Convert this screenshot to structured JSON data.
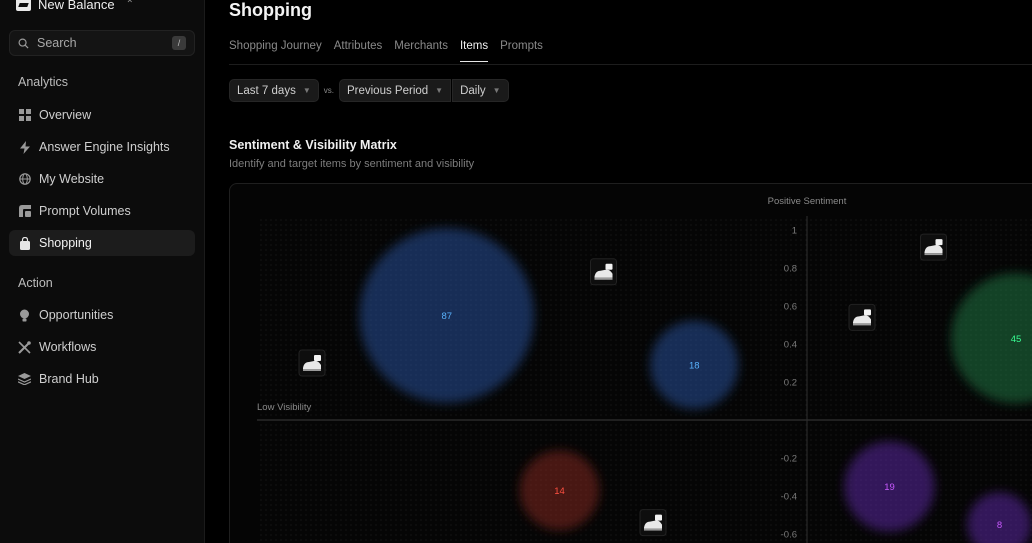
{
  "sidebar": {
    "brand": "New Balance",
    "search": {
      "placeholder": "Search",
      "shortcut": "/"
    },
    "sections": [
      {
        "label": "Analytics",
        "items": [
          {
            "label": "Overview",
            "icon": "grid-icon",
            "active": false
          },
          {
            "label": "Answer Engine Insights",
            "icon": "bolt-icon",
            "active": false
          },
          {
            "label": "My Website",
            "icon": "globe-icon",
            "active": false
          },
          {
            "label": "Prompt Volumes",
            "icon": "chart-icon",
            "active": false
          },
          {
            "label": "Shopping",
            "icon": "bag-icon",
            "active": true
          }
        ]
      },
      {
        "label": "Action",
        "items": [
          {
            "label": "Opportunities",
            "icon": "bulb-icon",
            "active": false
          },
          {
            "label": "Workflows",
            "icon": "tools-icon",
            "active": false
          },
          {
            "label": "Brand Hub",
            "icon": "layers-icon",
            "active": false
          }
        ]
      }
    ]
  },
  "main": {
    "title": "Shopping",
    "tabs": [
      {
        "label": "Shopping Journey",
        "active": false
      },
      {
        "label": "Attributes",
        "active": false
      },
      {
        "label": "Merchants",
        "active": false
      },
      {
        "label": "Items",
        "active": true
      },
      {
        "label": "Prompts",
        "active": false
      }
    ],
    "filters": {
      "range": "Last 7 days",
      "vs": "vs.",
      "compare": "Previous Period",
      "granularity": "Daily"
    },
    "matrix": {
      "title": "Sentiment & Visibility Matrix",
      "subtitle": "Identify and target items by sentiment and visibility"
    }
  },
  "chart_data": {
    "type": "scatter",
    "title": "Sentiment & Visibility Matrix",
    "top_label": "Positive Sentiment",
    "left_label": "Low Visibility",
    "y_ticks": [
      "1",
      "0.8",
      "0.6",
      "0.4",
      "0.2",
      "-0.2",
      "-0.4",
      "-0.6"
    ],
    "ylim": [
      -0.6,
      1
    ],
    "series": [
      {
        "label": "87",
        "x": 0.345,
        "y": 0.55,
        "color": "#2f5fb8"
      },
      {
        "label": "18",
        "x": 0.795,
        "y": 0.29,
        "color": "#2f5fb8"
      },
      {
        "label": "45",
        "x": 1.38,
        "y": 0.43,
        "color": "#1e8c4e"
      },
      {
        "label": "14",
        "x": 0.55,
        "y": -0.37,
        "color": "#9a2a22"
      },
      {
        "label": "19",
        "x": 1.15,
        "y": -0.35,
        "color": "#6a2fc0"
      },
      {
        "label": "8",
        "x": 1.35,
        "y": -0.55,
        "color": "#6a2fc0"
      }
    ],
    "products": [
      {
        "name": "shoe",
        "x": 0.1,
        "y": 0.3
      },
      {
        "name": "shoe",
        "x": 0.63,
        "y": 0.78
      },
      {
        "name": "shoe",
        "x": 1.23,
        "y": 0.91
      },
      {
        "name": "shoe",
        "x": 1.1,
        "y": 0.54
      },
      {
        "name": "shoe",
        "x": 0.72,
        "y": -0.54
      }
    ]
  }
}
